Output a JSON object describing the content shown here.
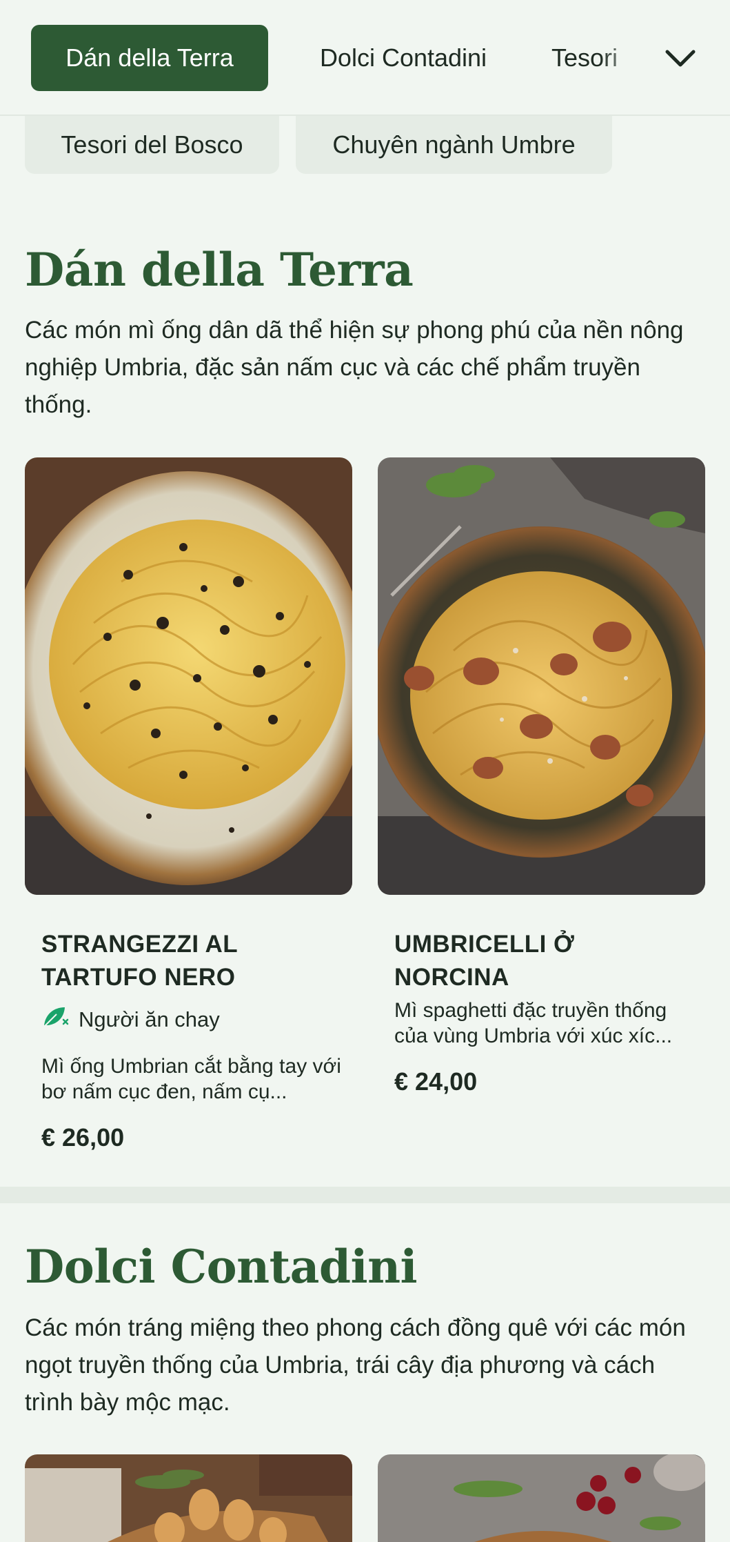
{
  "nav": {
    "tabs": [
      {
        "label": "Dán della Terra",
        "active": true
      },
      {
        "label": "Dolci Contadini",
        "active": false
      },
      {
        "label": "Tesori",
        "active": false
      }
    ],
    "expand_icon": "chevron-down-icon",
    "chips": [
      "Tesori del Bosco",
      "Chuyên ngành Umbre"
    ]
  },
  "sections": [
    {
      "title": "Dán della Terra",
      "description": "Các món mì ống dân dã thể hiện sự phong phú của nền nông nghiệp Umbria, đặc sản nấm cục và các chế phẩm truyền thống.",
      "items": [
        {
          "name": "STRANGEZZI AL TARTUFO NERO",
          "tag": "Người ăn chay",
          "tag_icon": "vegetarian-leaf-icon",
          "description": "Mì ống Umbrian cắt bằng tay với bơ nấm cục đen, nấm cụ...",
          "price": "€ 26,00"
        },
        {
          "name": "UMBRICELLI Ở NORCINA",
          "description": "Mì spaghetti đặc truyền thống của vùng Umbria với xúc xíc...",
          "price": "€ 24,00"
        }
      ]
    },
    {
      "title": "Dolci Contadini",
      "description": "Các món tráng miệng theo phong cách đồng quê với các món ngọt truyền thống của Umbria, trái cây địa phương và cách trình bày mộc mạc."
    }
  ],
  "colors": {
    "accent": "#2d5a34",
    "background": "#f1f6f1",
    "veg_icon": "#1aa36a"
  }
}
